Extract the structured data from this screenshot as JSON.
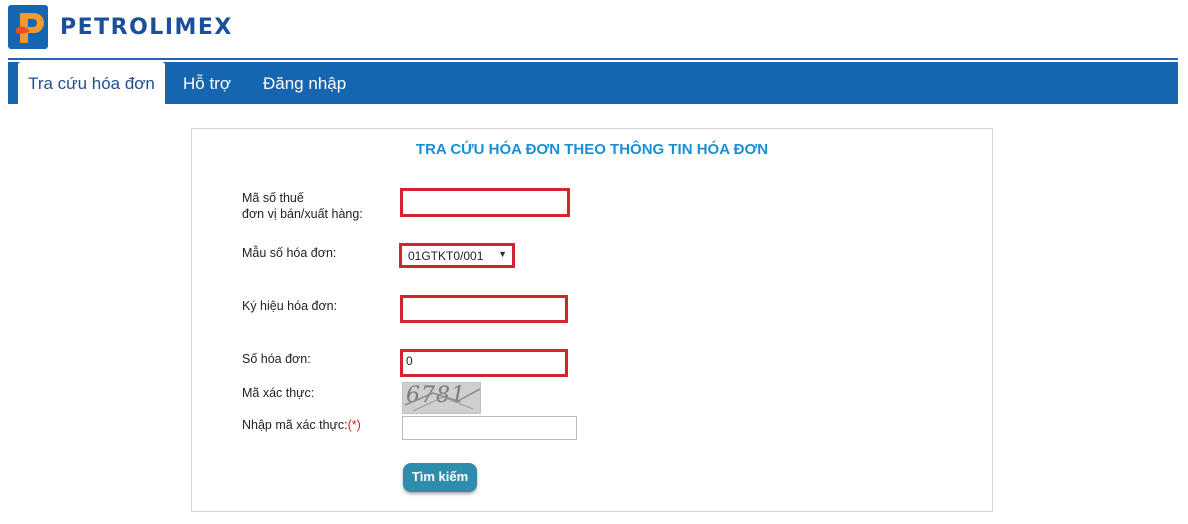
{
  "brand": {
    "name": "PETROLIMEX",
    "logo_icon": "petrolimex-logo-icon"
  },
  "nav": {
    "tabs": [
      {
        "label": "Tra cứu hóa đơn",
        "active": true
      },
      {
        "label": "Hỗ trợ",
        "active": false
      },
      {
        "label": "Đăng nhập",
        "active": false
      }
    ]
  },
  "form": {
    "title": "TRA CỨU HÓA ĐƠN THEO THÔNG TIN HÓA ĐƠN",
    "tax_code": {
      "label_line1": "Mã số thuế",
      "label_line2": "đơn vị bán/xuất hàng:",
      "value": ""
    },
    "invoice_template": {
      "label": "Mẫu số hóa đơn:",
      "selected": "01GTKT0/001"
    },
    "invoice_symbol": {
      "label": "Ký hiệu hóa đơn:",
      "value": ""
    },
    "invoice_number": {
      "label": "Số hóa đơn:",
      "value": "0"
    },
    "captcha": {
      "label": "Mã xác thực:",
      "text": "6781"
    },
    "captcha_input": {
      "label": "Nhập mã xác thực:",
      "required_mark": "(*)",
      "value": ""
    },
    "search_button": "Tìm kiếm"
  },
  "colors": {
    "navbar": "#1565b1",
    "title": "#1b8fd6",
    "highlight_border": "#d2262e",
    "button": "#2d8dab",
    "brand_text": "#1a4f9c"
  }
}
